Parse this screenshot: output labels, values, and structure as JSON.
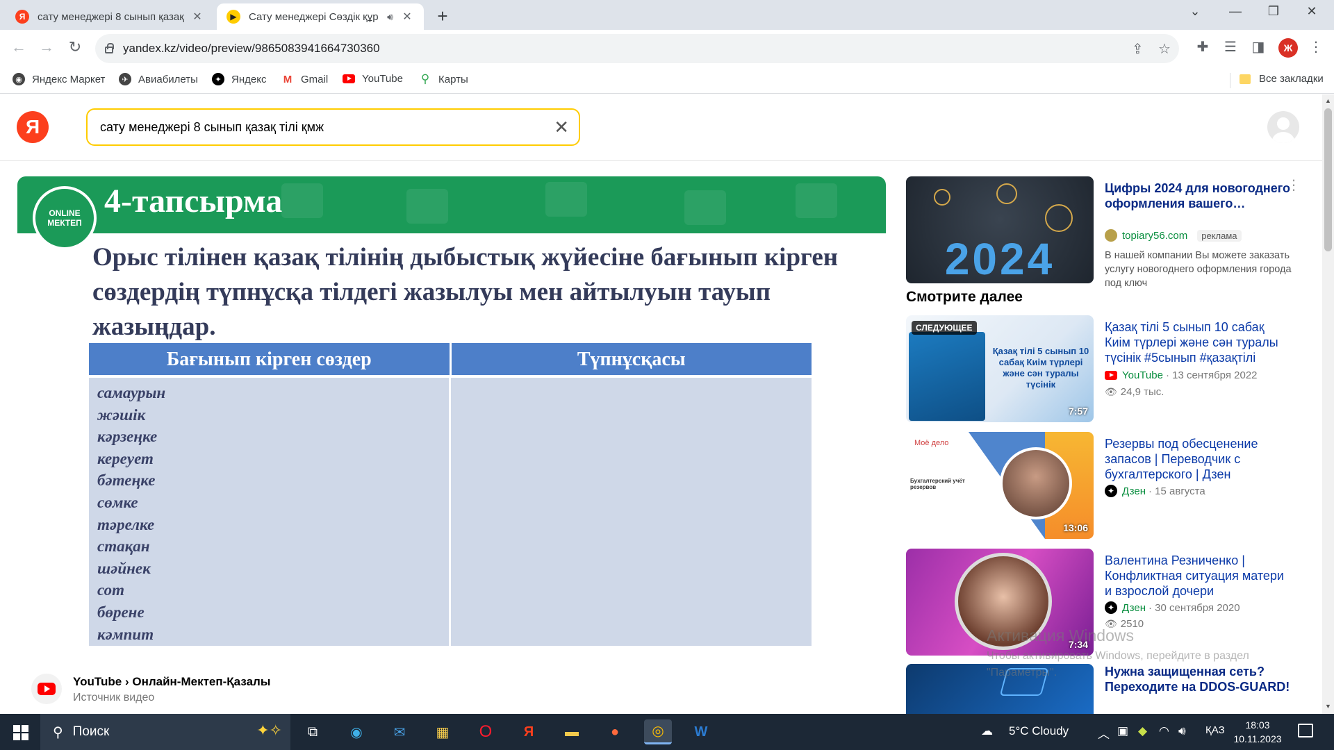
{
  "browser": {
    "tabs": [
      {
        "title": "сату менеджері 8 сынып қазақ",
        "favicon": "yandex-icon",
        "active": false
      },
      {
        "title": "Сату менеджері Сөздік құр",
        "favicon": "yandex-video-icon",
        "active": true
      }
    ],
    "new_tab_label": "+",
    "url": "yandex.kz/video/preview/9865083941664730360",
    "profile_letter": "Ж",
    "bookmarks": [
      {
        "label": "Яндекс Маркет",
        "icon": "market-icon",
        "color": "#444"
      },
      {
        "label": "Авиабилеты",
        "icon": "plane-icon",
        "color": "#444"
      },
      {
        "label": "Яндекс",
        "icon": "dzen-icon",
        "color": "#000"
      },
      {
        "label": "Gmail",
        "icon": "gmail-icon",
        "color": "#ea4335"
      },
      {
        "label": "YouTube",
        "icon": "youtube-icon",
        "color": "#ff0000"
      },
      {
        "label": "Карты",
        "icon": "maps-pin-icon",
        "color": "#34a853"
      }
    ],
    "all_bookmarks": "Все закладки"
  },
  "page": {
    "logo": "Я",
    "search_value": "сату менеджері 8 сынып қазақ тілі қмж",
    "video": {
      "badge": "ONLINE МЕКТЕП",
      "slide_title": "4-тапсырма",
      "slide_text": "Орыс тілінен қазақ тілінің дыбыстық жүйесіне бағынып кірген сөздердің түпнұсқа тілдегі жазылуы мен айтылуын тауып жазыңдар.",
      "table_headers": [
        "Бағынып кірген сөздер",
        "Түпнұсқасы"
      ],
      "words": [
        "самаурын",
        "жәшік",
        "кәрзеңке",
        "кереует",
        "бәтеңке",
        "сөмке",
        "тәрелке",
        "стақан",
        "шәйнек",
        "сот",
        "бөрене",
        "кәмпит"
      ]
    },
    "source": {
      "platform": "YouTube",
      "separator": "›",
      "channel": "Онлайн-Мектеп-Қазалы",
      "subtitle": "Источник видео"
    },
    "sidebar": {
      "ad": {
        "thumb_text": "2024",
        "title": "Цифры 2024 для новогоднего оформления вашего…",
        "site": "topiary56.com",
        "ad_label": "реклама",
        "description": "В нашей компании Вы можете заказать услугу новогоднего оформления города под ключ"
      },
      "see_more": "Смотрите далее",
      "videos": [
        {
          "title": "Қазақ тілі 5 сынып 10 сабақ Киім түрлері және сән туралы түсінік #5сынып #қазақтілі",
          "channel": "YouTube",
          "channel_icon": "youtube-icon",
          "date": "· 13 сентября 2022",
          "views": "24,9 тыс.",
          "duration": "7:57",
          "badge": "СЛЕДУЮЩЕЕ",
          "thumb_text": "Қазақ тілі 5 сынып 10 сабақ Киім түрлері және сән туралы түсінік"
        },
        {
          "title": "Резервы под обесценение запасов | Переводчик с бухгалтерского | Дзен",
          "channel": "Дзен",
          "channel_icon": "dzen-icon",
          "date": "· 15 августа",
          "views": "",
          "duration": "13:06",
          "badge": "",
          "thumb_text": "Бухгалтерский учёт резервов"
        },
        {
          "title": "Валентина Резниченко | Конфликтная ситуация матери и взрослой дочери",
          "channel": "Дзен",
          "channel_icon": "dzen-icon",
          "date": "· 30 сентября 2020",
          "views": "2510",
          "duration": "7:34",
          "badge": "",
          "thumb_text": ""
        },
        {
          "title": "Нужна защищенная сеть? Переходите на DDOS-GUARD!",
          "channel": "",
          "channel_icon": "",
          "date": "",
          "views": "",
          "duration": "",
          "badge": "",
          "thumb_text": ""
        }
      ]
    },
    "watermark": {
      "line1": "Активация Windows",
      "line2": "Чтобы активировать Windows, перейдите в раздел",
      "line3": "\"Параметры\"."
    }
  },
  "taskbar": {
    "search_label": "Поиск",
    "weather": "5°C  Cloudy",
    "lang": "ҚАЗ",
    "time": "18:03",
    "date": "10.11.2023"
  }
}
